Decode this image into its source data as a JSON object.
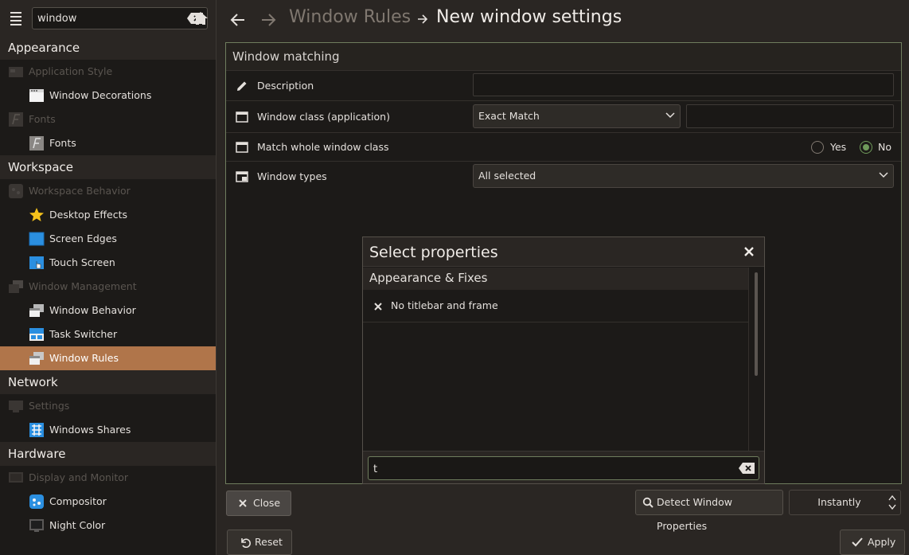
{
  "sidebar": {
    "search_value": "window",
    "sections": [
      {
        "title": "Appearance"
      },
      {
        "title": "Workspace"
      },
      {
        "title": "Network"
      },
      {
        "title": "Hardware"
      }
    ],
    "categories": [
      "Application Style",
      "Fonts",
      "Workspace Behavior",
      "Window Management",
      "Settings",
      "Display and Monitor"
    ],
    "items": [
      "Window Decorations",
      "Fonts",
      "Desktop Effects",
      "Screen Edges",
      "Touch Screen",
      "Window Behavior",
      "Task Switcher",
      "Window Rules",
      "Windows Shares",
      "Compositor",
      "Night Color"
    ]
  },
  "header": {
    "crumb_parent": "Window Rules",
    "crumb_current": "New window settings"
  },
  "panel": {
    "title": "Window matching",
    "rows": [
      {
        "label": "Description",
        "value": ""
      },
      {
        "label": "Window class (application)",
        "combo": "Exact Match",
        "value": ""
      },
      {
        "label": "Match whole window class",
        "yes": "Yes",
        "no": "No",
        "selected": "No"
      },
      {
        "label": "Window types",
        "combo": "All selected"
      }
    ]
  },
  "dialog": {
    "title": "Select properties",
    "group": "Appearance & Fixes",
    "item": "No titlebar and frame",
    "search_value": "t"
  },
  "buttons": {
    "close": "Close",
    "detect": "Detect Window Properties",
    "delay": "Instantly",
    "reset": "Reset",
    "apply": "Apply"
  },
  "colors": {
    "accent": "#b0754a",
    "focus_border": "#6f7d5e",
    "radio_checked": "#6f9a5a"
  }
}
